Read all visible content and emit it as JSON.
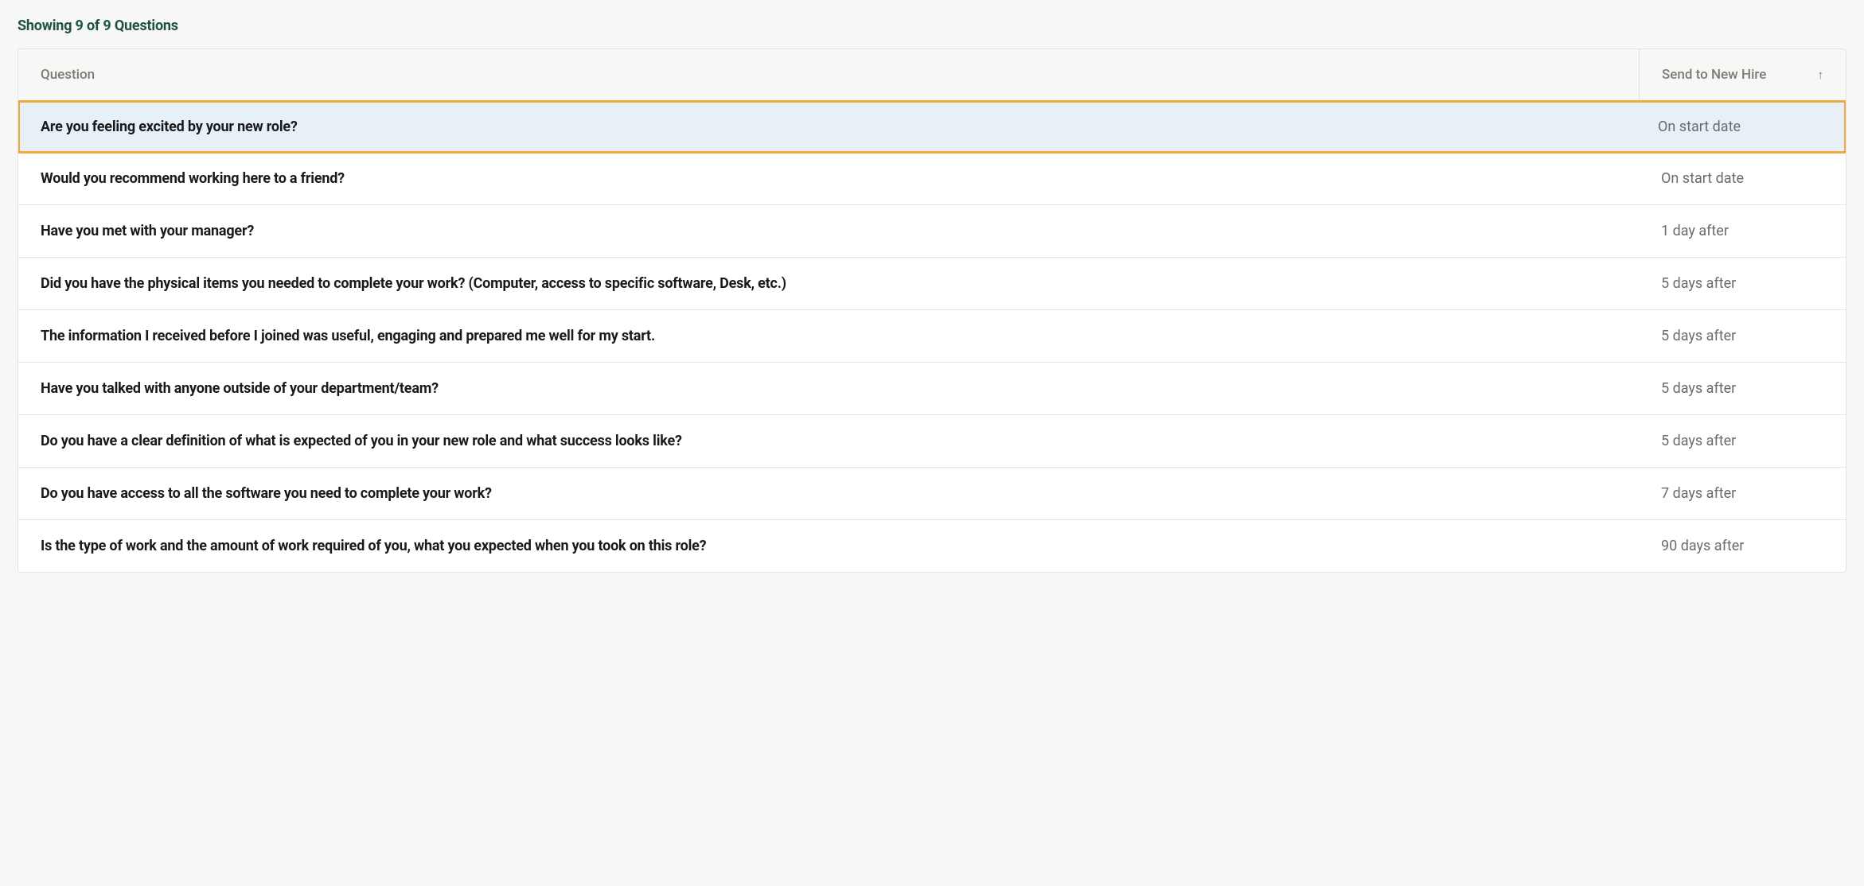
{
  "countLabel": "Showing 9 of 9 Questions",
  "header": {
    "questionCol": "Question",
    "sendCol": "Send to New Hire",
    "sortIcon": "↑"
  },
  "rows": [
    {
      "question": "Are you feeling excited by your new role?",
      "send": "On start date",
      "highlighted": true
    },
    {
      "question": "Would you recommend working here to a friend?",
      "send": "On start date",
      "highlighted": false
    },
    {
      "question": "Have you met with your manager?",
      "send": "1 day after",
      "highlighted": false
    },
    {
      "question": "Did you have the physical items you needed to complete your work? (Computer, access to specific software, Desk, etc.)",
      "send": "5 days after",
      "highlighted": false
    },
    {
      "question": "The information I received before I joined was useful, engaging and prepared me well for my start.",
      "send": "5 days after",
      "highlighted": false
    },
    {
      "question": "Have you talked with anyone outside of your department/team?",
      "send": "5 days after",
      "highlighted": false
    },
    {
      "question": "Do you have a clear definition of what is expected of you in your new role and what success looks like?",
      "send": "5 days after",
      "highlighted": false
    },
    {
      "question": "Do you have access to all the software you need to complete your work?",
      "send": "7 days after",
      "highlighted": false
    },
    {
      "question": "Is the type of work and the amount of work required of you, what you expected when you took on this role?",
      "send": "90 days after",
      "highlighted": false
    }
  ]
}
